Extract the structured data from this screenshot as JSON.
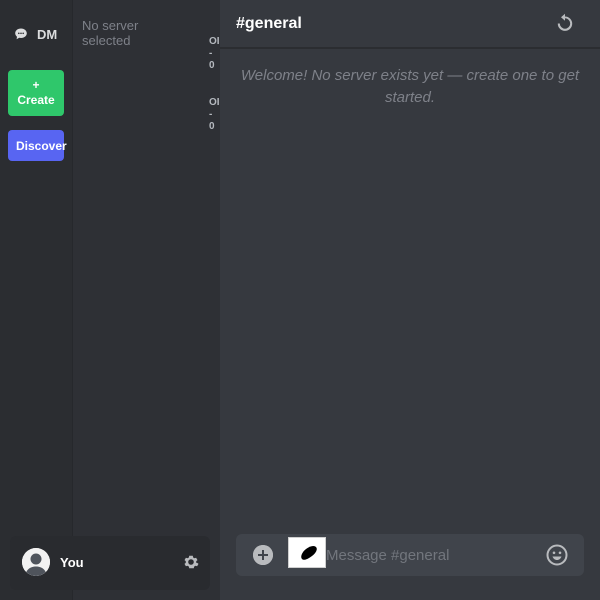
{
  "sidebar": {
    "dm_label": "DM",
    "create_label": "+\nCreate",
    "create_plus": "+",
    "create_text": "Create",
    "discover_label": "Discover"
  },
  "channels": {
    "empty_text": "No server selected",
    "online_a": [
      "OI",
      "-",
      "0"
    ],
    "online_b": [
      "OI",
      "-",
      "0"
    ]
  },
  "user": {
    "name": "You"
  },
  "chat": {
    "channel": "#general",
    "welcome": "Welcome! No server exists yet — create one to get started.",
    "composer_placeholder": "Message #general"
  },
  "icons": {
    "dm": "chat-bubble-icon",
    "settings": "gear-icon",
    "refresh": "refresh-icon",
    "attach": "plus-circle-icon",
    "emoji": "smile-icon"
  },
  "colors": {
    "create": "#2fc76b",
    "discover": "#5865f2",
    "background": "#36393f"
  }
}
